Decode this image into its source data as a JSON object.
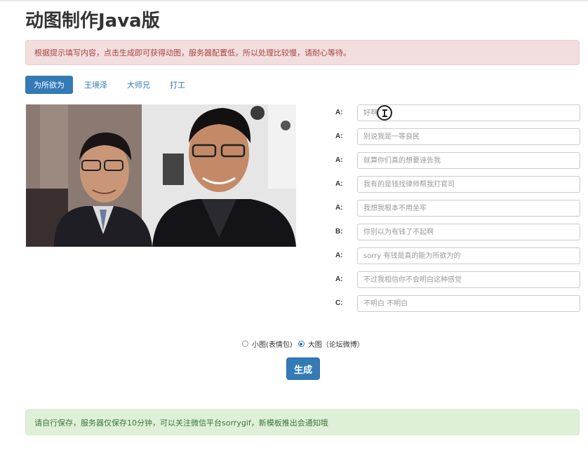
{
  "page": {
    "title": "动图制作Java版",
    "notice": "根据提示填写内容，点击生成即可获得动图，服务器配置低，所以处理比较慢，请耐心等待。",
    "footer_notice": "请自行保存，服务器仅保存10分钟，可以关注微信平台sorrygif，新模板推出会通知哦"
  },
  "tabs": [
    {
      "label": "为所欲为",
      "active": true
    },
    {
      "label": "王境泽",
      "active": false
    },
    {
      "label": "大师兄",
      "active": false
    },
    {
      "label": "打工",
      "active": false
    }
  ],
  "lines": [
    {
      "speaker": "A:",
      "value": "",
      "placeholder": "好啊"
    },
    {
      "speaker": "A:",
      "value": "",
      "placeholder": "别说我是一等良民"
    },
    {
      "speaker": "A:",
      "value": "",
      "placeholder": "就算你们真的想要诬告我"
    },
    {
      "speaker": "A:",
      "value": "",
      "placeholder": "我有的是钱找律师帮我打官司"
    },
    {
      "speaker": "A:",
      "value": "",
      "placeholder": "我想我根本不用坐牢"
    },
    {
      "speaker": "B:",
      "value": "",
      "placeholder": "你别以为有钱了不起啊"
    },
    {
      "speaker": "A:",
      "value": "",
      "placeholder": "sorry 有钱是真的能为所欲为的"
    },
    {
      "speaker": "A:",
      "value": "",
      "placeholder": "不过我相信你不会明白这种感觉"
    },
    {
      "speaker": "C:",
      "value": "",
      "placeholder": "不明白 不明白"
    }
  ],
  "size_options": [
    {
      "label": "小图(表情包)",
      "checked": false
    },
    {
      "label": "大图（论坛微博）",
      "checked": true
    }
  ],
  "generate_button": "生成",
  "colors": {
    "primary": "#337ab7",
    "danger_bg": "#f2dede",
    "danger_text": "#a94442",
    "success_bg": "#dff0d8",
    "success_text": "#3c763d"
  }
}
